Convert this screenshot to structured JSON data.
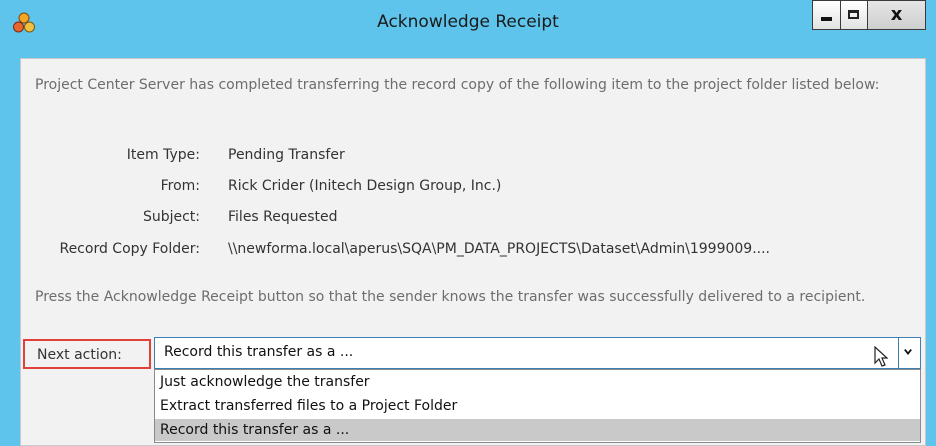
{
  "window": {
    "title": "Acknowledge Receipt",
    "controls": {
      "minimize": "minimize",
      "maximize": "maximize",
      "close": "x"
    }
  },
  "message": "Project Center Server has completed transferring the record copy of the following item to the project folder listed below:",
  "fields": [
    {
      "label": "Item Type:",
      "value": "Pending Transfer"
    },
    {
      "label": "From:",
      "value": "Rick Crider (Initech Design Group, Inc.)"
    },
    {
      "label": "Subject:",
      "value": "Files Requested"
    },
    {
      "label": "Record Copy Folder:",
      "value": "\\\\newforma.local\\aperus\\SQA\\PM_DATA_PROJECTS\\Dataset\\Admin\\1999009...."
    }
  ],
  "instruction": "Press the Acknowledge Receipt button so that the sender knows the transfer was successfully delivered to a recipient.",
  "next_action": {
    "label": "Next action:",
    "selected": "Record this transfer as a ...",
    "options": [
      "Just acknowledge the transfer",
      "Extract transferred files to a Project Folder",
      "Record this transfer as a ..."
    ],
    "highlighted_index": 2
  },
  "colors": {
    "title_bar": "#5ec4eb",
    "panel": "#f2f2f2",
    "highlight_box": "#e0413a",
    "combo_border": "#3c7fb1",
    "selected_option": "#c9c9c9"
  }
}
